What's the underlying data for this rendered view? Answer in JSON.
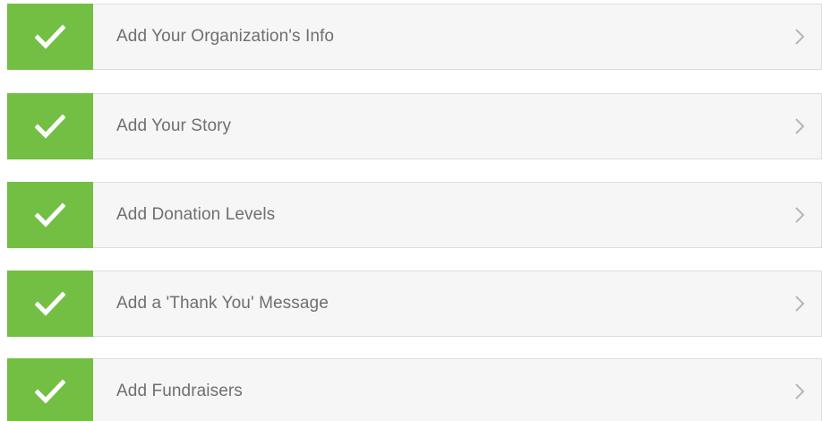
{
  "steps": [
    {
      "label": "Add Your Organization's Info",
      "status": "complete",
      "status_icon": "check-icon",
      "nav_icon": "chevron-right-icon"
    },
    {
      "label": "Add Your Story",
      "status": "complete",
      "status_icon": "check-icon",
      "nav_icon": "chevron-right-icon"
    },
    {
      "label": "Add Donation Levels",
      "status": "complete",
      "status_icon": "check-icon",
      "nav_icon": "chevron-right-icon"
    },
    {
      "label": "Add a 'Thank You' Message",
      "status": "complete",
      "status_icon": "check-icon",
      "nav_icon": "chevron-right-icon"
    },
    {
      "label": "Add Fundraisers",
      "status": "complete",
      "status_icon": "check-icon",
      "nav_icon": "chevron-right-icon"
    }
  ],
  "colors": {
    "complete_green": "#72bf44",
    "row_background": "#f6f6f6",
    "row_border": "#dcdcdc",
    "label_text": "#6f6f6f",
    "chevron": "#b5b5b5"
  }
}
